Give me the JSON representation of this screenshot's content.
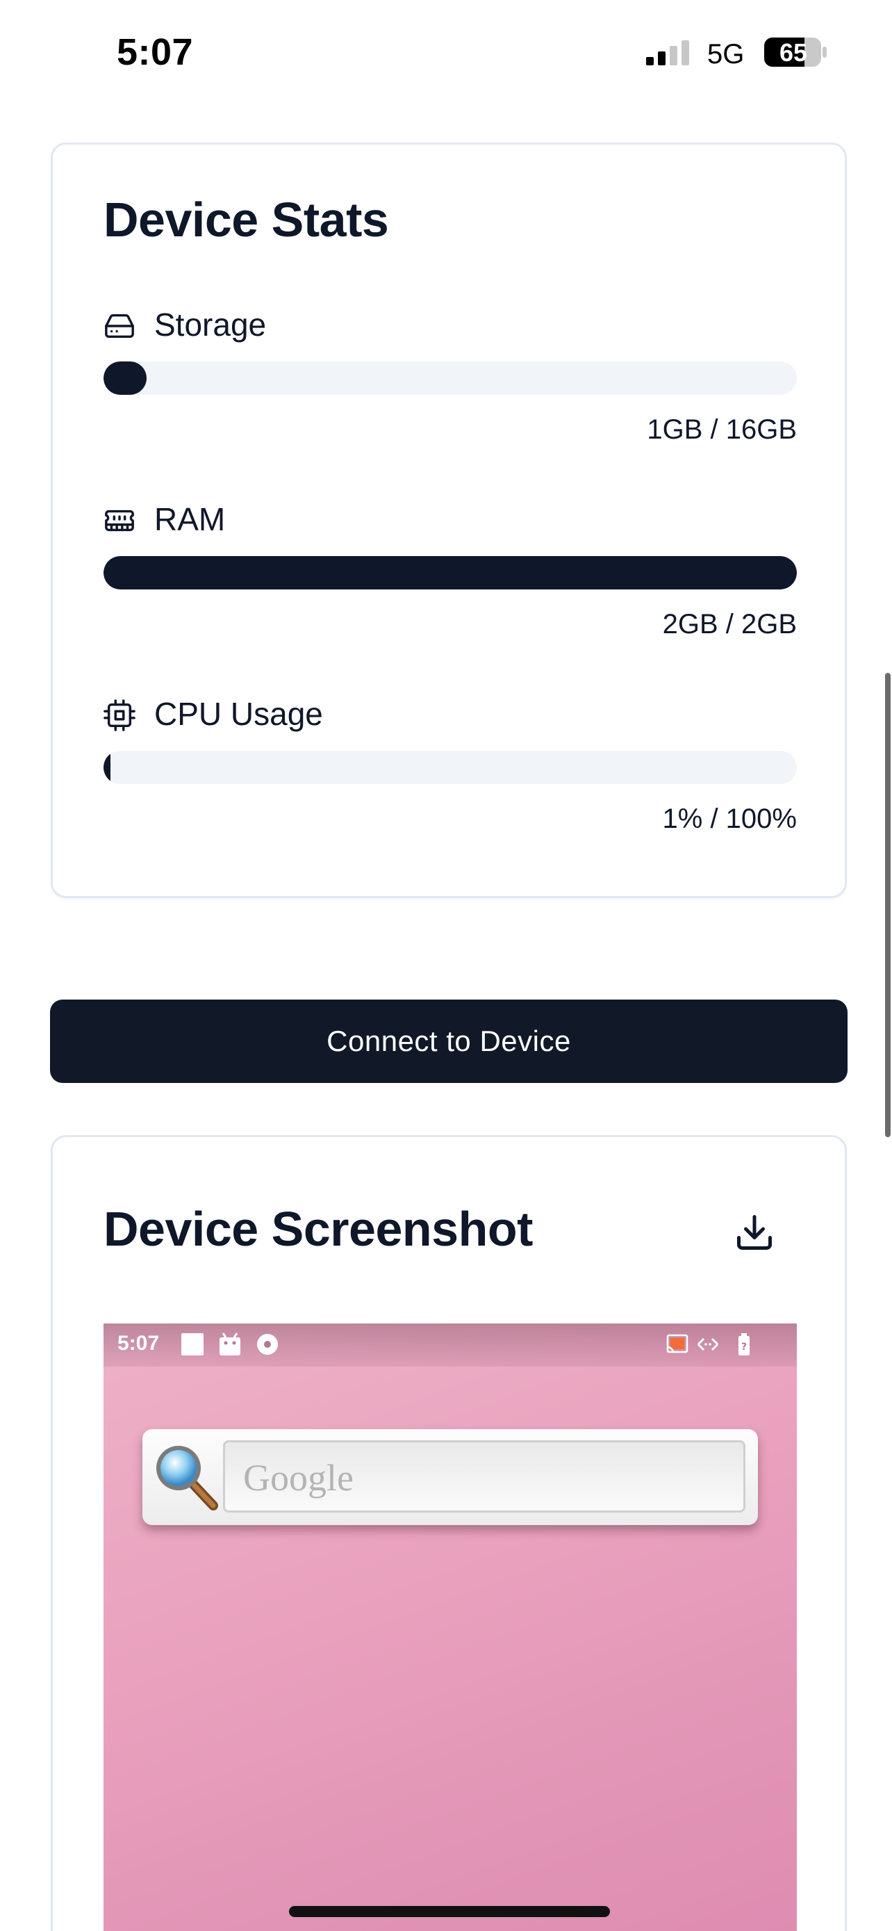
{
  "status_bar": {
    "time": "5:07",
    "network": "5G",
    "battery": "65"
  },
  "device_stats": {
    "title": "Device Stats",
    "stats": [
      {
        "label": "Storage",
        "icon": "hard-drive-icon",
        "value_text": "1GB / 16GB",
        "fraction": 0.0625
      },
      {
        "label": "RAM",
        "icon": "memory-stick-icon",
        "value_text": "2GB / 2GB",
        "fraction": 1.0
      },
      {
        "label": "CPU Usage",
        "icon": "cpu-icon",
        "value_text": "1% / 100%",
        "fraction": 0.01
      }
    ]
  },
  "connect_button": {
    "label": "Connect to Device"
  },
  "device_screenshot": {
    "title": "Device Screenshot",
    "download_icon": "download-icon",
    "preview": {
      "time": "5:07",
      "search_placeholder": "Google"
    }
  },
  "colors": {
    "primary": "#0f172a",
    "button": "#111827",
    "track": "#f1f5f9",
    "border": "#e2e8f0",
    "wallpaper": "#e9a1bd"
  }
}
